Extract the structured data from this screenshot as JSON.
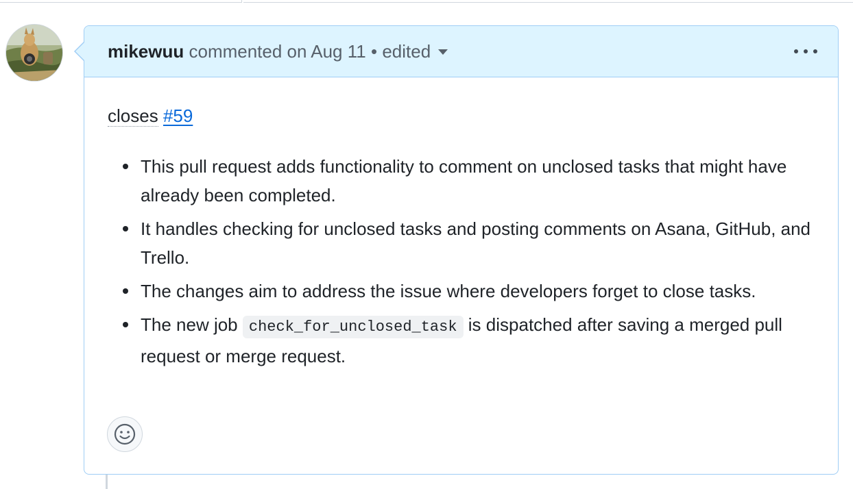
{
  "comment": {
    "author": "mikewuu",
    "meta_text": "commented on Aug 11",
    "separator": "•",
    "edited_label": "edited",
    "closes_prefix": "closes",
    "closes_issue": "#59",
    "bullets": [
      "This pull request adds functionality to comment on unclosed tasks that might have already been completed.",
      "It handles checking for unclosed tasks and posting comments on Asana, GitHub, and Trello.",
      "The changes aim to address the issue where developers forget to close tasks."
    ],
    "bullet4": {
      "before": "The new job",
      "code": "check_for_unclosed_task",
      "after": "is dispatched after saving a merged pull request or merge request."
    }
  },
  "icons": {
    "menu": "kebab-horizontal-icon",
    "dropdown": "triangle-down-icon",
    "reaction": "smiley-icon"
  },
  "colors": {
    "header_bg": "#ddf4ff",
    "header_border": "#9fcdf5",
    "link": "#0969da"
  }
}
